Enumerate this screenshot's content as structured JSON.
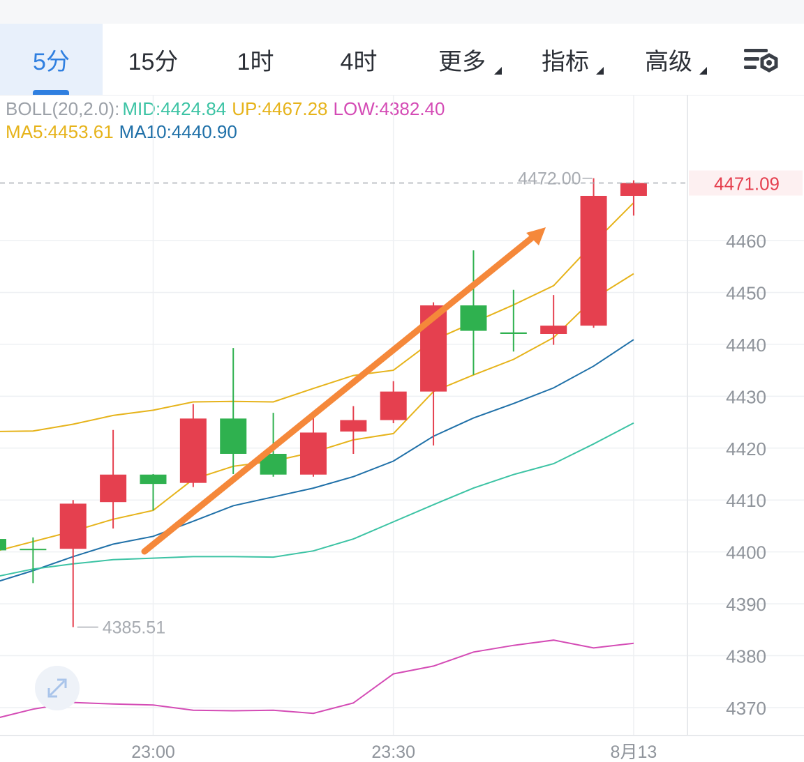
{
  "tabs": [
    {
      "label": "5分",
      "active": true
    },
    {
      "label": "15分"
    },
    {
      "label": "1时"
    },
    {
      "label": "4时"
    },
    {
      "label": "更多",
      "dropdown": true
    },
    {
      "label": "指标",
      "dropdown": true
    },
    {
      "label": "高级",
      "dropdown": true
    }
  ],
  "settings_icon": "chart-settings-icon",
  "expand_icon": "expand-arrows-icon",
  "legend": {
    "boll_label": "BOLL(20,2.0):",
    "mid": "MID:4424.84",
    "up": "UP:4467.28",
    "low": "LOW:4382.40",
    "ma5": "MA5:4453.61",
    "ma10": "MA10:4440.90"
  },
  "colors": {
    "up_candle": "#e5404f",
    "down_candle": "#2fb14f",
    "mid": "#3cc3a4",
    "up": "#e6b31a",
    "low": "#d44bb5",
    "ma5": "#e6b31a",
    "ma10": "#1f70a8",
    "accent": "#2f7fe0",
    "trend_arrow": "#f5883a"
  },
  "chart_data": {
    "type": "candlestick",
    "ylim": [
      4365,
      4478
    ],
    "y_ticks": [
      4370,
      4380,
      4390,
      4400,
      4410,
      4420,
      4430,
      4440,
      4450,
      4460
    ],
    "x_ticks": [
      {
        "label": "23:00",
        "index": 4
      },
      {
        "label": "23:30",
        "index": 10
      },
      {
        "label": "8月13",
        "index": 16
      }
    ],
    "current_price": "4471.09",
    "max_label": "4472.00",
    "min_label": "4385.51",
    "candles": [
      {
        "o": 4402.5,
        "h": 4403.0,
        "l": 4400.0,
        "c": 4400.3
      },
      {
        "o": 4400.6,
        "h": 4402.8,
        "l": 4394.0,
        "c": 4400.5
      },
      {
        "o": 4400.6,
        "h": 4410.0,
        "l": 4385.51,
        "c": 4409.3
      },
      {
        "o": 4409.6,
        "h": 4423.5,
        "l": 4404.5,
        "c": 4414.9
      },
      {
        "o": 4414.9,
        "h": 4415.0,
        "l": 4408.0,
        "c": 4413.1
      },
      {
        "o": 4413.3,
        "h": 4428.5,
        "l": 4412.5,
        "c": 4425.7
      },
      {
        "o": 4425.7,
        "h": 4439.3,
        "l": 4415.0,
        "c": 4418.9
      },
      {
        "o": 4418.9,
        "h": 4426.8,
        "l": 4414.5,
        "c": 4414.9
      },
      {
        "o": 4414.9,
        "h": 4426.0,
        "l": 4414.5,
        "c": 4423.0
      },
      {
        "o": 4423.2,
        "h": 4428.1,
        "l": 4418.9,
        "c": 4425.4
      },
      {
        "o": 4425.4,
        "h": 4432.9,
        "l": 4424.8,
        "c": 4430.9
      },
      {
        "o": 4430.9,
        "h": 4448.1,
        "l": 4420.5,
        "c": 4447.5
      },
      {
        "o": 4447.5,
        "h": 4458.1,
        "l": 4434.1,
        "c": 4442.6
      },
      {
        "o": 4442.3,
        "h": 4450.5,
        "l": 4438.6,
        "c": 4442.0
      },
      {
        "o": 4442.0,
        "h": 4449.5,
        "l": 4439.9,
        "c": 4443.6
      },
      {
        "o": 4443.6,
        "h": 4472.0,
        "l": 4443.2,
        "c": 4468.6
      },
      {
        "o": 4468.6,
        "h": 4471.6,
        "l": 4464.8,
        "c": 4471.09
      }
    ],
    "series": [
      {
        "key": "up",
        "values": [
          4423.2,
          4423.3,
          4424.6,
          4426.3,
          4427.3,
          4428.9,
          4429.0,
          4428.9,
          4431.5,
          4434.0,
          4435.0,
          4440.8,
          4444.2,
          4447.6,
          4451.3,
          4459.5,
          4467.28
        ]
      },
      {
        "key": "ma5",
        "values": [
          4400.0,
          4402.0,
          4404.0,
          4406.3,
          4408.0,
          4414.0,
          4416.5,
          4417.5,
          4419.2,
          4421.6,
          4422.8,
          4430.9,
          4434.1,
          4437.1,
          4441.3,
          4448.8,
          4453.61
        ]
      },
      {
        "key": "ma10",
        "values": [
          4394.0,
          4396.4,
          4399.1,
          4401.5,
          4403.0,
          4405.9,
          4408.9,
          4410.6,
          4412.3,
          4414.5,
          4417.5,
          4422.3,
          4425.8,
          4428.6,
          4431.6,
          4435.8,
          4440.9
        ]
      },
      {
        "key": "mid",
        "values": [
          4395.1,
          4396.7,
          4397.7,
          4398.5,
          4398.8,
          4399.1,
          4399.1,
          4399.0,
          4400.2,
          4402.5,
          4405.8,
          4409.1,
          4412.3,
          4414.9,
          4417.0,
          4420.8,
          4424.84
        ]
      },
      {
        "key": "low",
        "values": [
          4367.8,
          4369.7,
          4371.0,
          4370.7,
          4370.5,
          4369.5,
          4369.4,
          4369.5,
          4368.9,
          4370.9,
          4376.5,
          4378.0,
          4380.7,
          4382.0,
          4383.0,
          4381.5,
          4382.4
        ]
      }
    ]
  }
}
